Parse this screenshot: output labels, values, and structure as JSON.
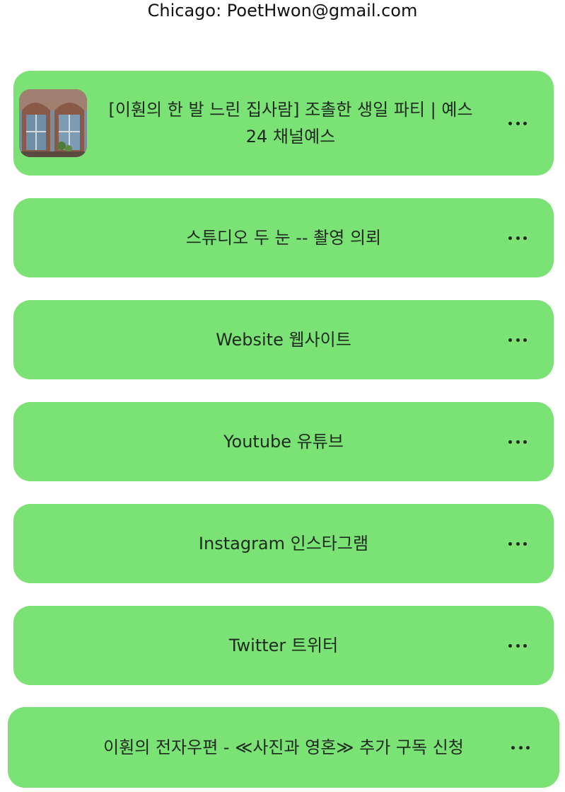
{
  "header": {
    "text": "Chicago: PoetHwon@gmail.com"
  },
  "links": [
    {
      "label": "[이훤의 한 발 느린 집사람] 조촐한 생일 파티 | 예스24 채널예스",
      "has_thumbnail": true,
      "thumbnail_icon": "building-window-photo"
    },
    {
      "label": "스튜디오 두 눈 -- 촬영 의뢰"
    },
    {
      "label": "Website 웹사이트"
    },
    {
      "label": "Youtube 유튜브"
    },
    {
      "label": "Instagram 인스타그램"
    },
    {
      "label": "Twitter 트위터"
    },
    {
      "label": "이훤의 전자우편 - ≪사진과 영혼≫ 추가 구독 신청"
    }
  ],
  "more_icon": "more-horizontal-icon",
  "colors": {
    "card_background": "#7be275",
    "text": "#1f2a1f",
    "page_background": "#ffffff"
  }
}
